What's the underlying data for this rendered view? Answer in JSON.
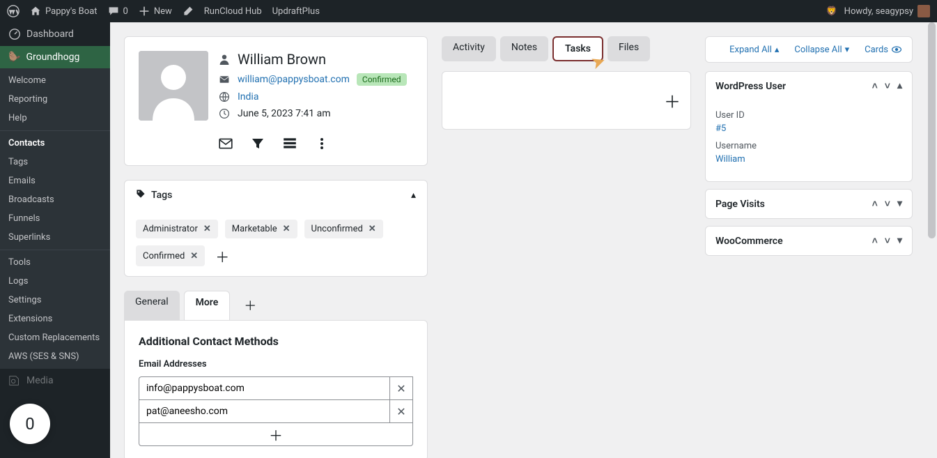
{
  "adminbar": {
    "site": "Pappy's Boat",
    "comments": "0",
    "newlabel": "New",
    "runcloud": "RunCloud Hub",
    "updraft": "UpdraftPlus",
    "howdy": "Howdy, seagypsy"
  },
  "sidebar": {
    "dashboard": "Dashboard",
    "plugin": "Groundhogg",
    "subs": [
      "Welcome",
      "Reporting",
      "Help",
      "Contacts",
      "Tags",
      "Emails",
      "Broadcasts",
      "Funnels",
      "Superlinks",
      "Tools",
      "Logs",
      "Settings",
      "Extensions",
      "Custom Replacements",
      "AWS (SES & SNS)"
    ],
    "media": "Media"
  },
  "contact": {
    "name": "William Brown",
    "email": "william@pappysboat.com",
    "status": "Confirmed",
    "country": "India",
    "date": "June 5, 2023 7:41 am"
  },
  "tags": {
    "title": "Tags",
    "items": [
      "Administrator",
      "Marketable",
      "Unconfirmed",
      "Confirmed"
    ]
  },
  "detailtabs": {
    "general": "General",
    "more": "More"
  },
  "additional": {
    "title": "Additional Contact Methods",
    "emailLabel": "Email Addresses",
    "emails": [
      "info@pappysboat.com",
      "pat@aneesho.com"
    ]
  },
  "midtabs": [
    "Activity",
    "Notes",
    "Tasks",
    "Files"
  ],
  "topctls": {
    "expand": "Expand All",
    "collapse": "Collapse All",
    "cards": "Cards"
  },
  "right": {
    "wp": {
      "title": "WordPress User",
      "useridLabel": "User ID",
      "userid": "#5",
      "usernameLabel": "Username",
      "username": "William"
    },
    "pv": "Page Visits",
    "wc": "WooCommerce"
  },
  "bubble": "0"
}
